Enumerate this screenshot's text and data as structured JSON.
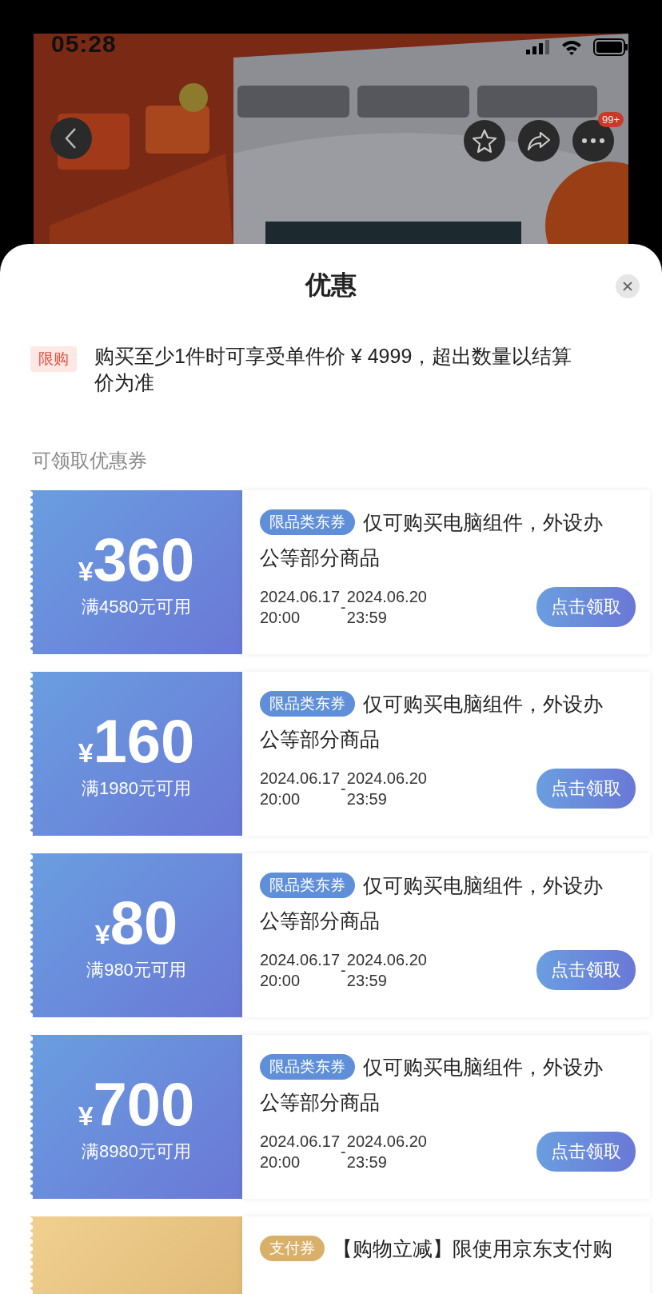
{
  "status_bar": {
    "time": "05:28"
  },
  "nav": {
    "badge": "99+"
  },
  "sheet": {
    "title": "优惠",
    "limit": {
      "tag": "限购",
      "text": "购买至少1件时可享受单件价 ¥ 4999，超出数量以结算价为准"
    },
    "section_title": "可领取优惠券",
    "coupons": [
      {
        "kind": "category",
        "currency": "¥",
        "amount": "360",
        "condition": "满4580元可用",
        "tag": "限品类东券",
        "description_lines": [
          "仅可购买电脑组件，外设办",
          "公等部分商品"
        ],
        "start_date": "2024.06.17",
        "start_time": "20:00",
        "separator": "-",
        "end_date": "2024.06.20",
        "end_time": "23:59",
        "button": "点击领取"
      },
      {
        "kind": "category",
        "currency": "¥",
        "amount": "160",
        "condition": "满1980元可用",
        "tag": "限品类东券",
        "description_lines": [
          "仅可购买电脑组件，外设办",
          "公等部分商品"
        ],
        "start_date": "2024.06.17",
        "start_time": "20:00",
        "separator": "-",
        "end_date": "2024.06.20",
        "end_time": "23:59",
        "button": "点击领取"
      },
      {
        "kind": "category",
        "currency": "¥",
        "amount": "80",
        "condition": "满980元可用",
        "tag": "限品类东券",
        "description_lines": [
          "仅可购买电脑组件，外设办",
          "公等部分商品"
        ],
        "start_date": "2024.06.17",
        "start_time": "20:00",
        "separator": "-",
        "end_date": "2024.06.20",
        "end_time": "23:59",
        "button": "点击领取"
      },
      {
        "kind": "category",
        "currency": "¥",
        "amount": "700",
        "condition": "满8980元可用",
        "tag": "限品类东券",
        "description_lines": [
          "仅可购买电脑组件，外设办",
          "公等部分商品"
        ],
        "start_date": "2024.06.17",
        "start_time": "20:00",
        "separator": "-",
        "end_date": "2024.06.20",
        "end_time": "23:59",
        "button": "点击领取"
      },
      {
        "kind": "payment",
        "tag": "支付券",
        "description_lines": [
          "【购物立减】限使用京东支付购"
        ]
      }
    ]
  }
}
